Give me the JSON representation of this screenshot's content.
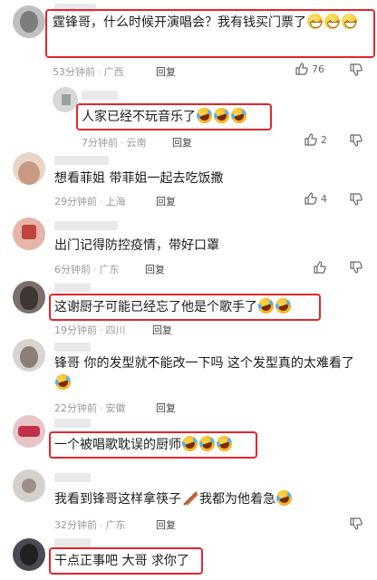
{
  "ui": {
    "reply_label": "回复",
    "separator": "·"
  },
  "comments": [
    {
      "text": "霆锋哥，什么时候开演唱会？我有钱买门票了",
      "time": "53分钟前",
      "location": "广西",
      "likes": "76"
    },
    {
      "text": "人家已经不玩音乐了",
      "time": "7分钟前",
      "location": "云南",
      "likes": "2"
    },
    {
      "text": "想看菲姐 带菲姐一起去吃饭撒",
      "time": "29分钟前",
      "location": "上海",
      "likes": "4"
    },
    {
      "text": "出门记得防控疫情，带好口罩",
      "time": "6分钟前",
      "location": "广东",
      "likes": ""
    },
    {
      "text": "这谢厨子可能已经忘了他是个歌手了",
      "time": "19分钟前",
      "location": "四川",
      "likes": ""
    },
    {
      "text": "锋哥 你的发型就不能改一下吗 这个发型真的太难看了",
      "time": "22分钟前",
      "location": "安徽",
      "likes": ""
    },
    {
      "text": "一个被唱歌耽误的厨师",
      "time": "",
      "location": "",
      "likes": ""
    },
    {
      "text": "我看到锋哥这样拿筷子",
      "text2": "我都为他着急",
      "time": "32分钟前",
      "location": "广东",
      "likes": ""
    },
    {
      "text": "干点正事吧 大哥 求你了",
      "time": "",
      "location": "",
      "likes": ""
    }
  ],
  "icons": {
    "emoji_grin": "grinning-face",
    "emoji_laugh": "rolling-on-floor-laughing",
    "like": "thumbs-up",
    "dislike": "thumbs-down",
    "chopsticks": "chopsticks"
  },
  "colors": {
    "highlight": "#e4262a",
    "meta": "#9a9a9a",
    "text": "#1c1c1c"
  }
}
